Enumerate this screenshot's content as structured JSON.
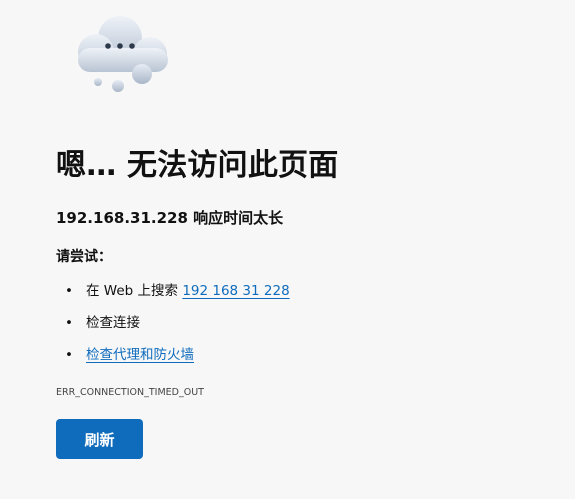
{
  "error_page": {
    "cloud_icon": "cloud-with-dots-icon",
    "title": "嗯… 无法访问此页面",
    "message": "192.168.31.228 响应时间太长",
    "try_heading": "请尝试：",
    "suggestions": [
      {
        "prefix": "在 Web 上搜索 ",
        "link": "192 168 31 228"
      },
      {
        "text": "检查连接"
      },
      {
        "link": "检查代理和防火墙"
      }
    ],
    "bullet": "•",
    "error_code": "ERR_CONNECTION_TIMED_OUT",
    "refresh_label": "刷新"
  },
  "colors": {
    "background": "#f7f7f7",
    "accent": "#0f6cbd",
    "text": "#111111"
  }
}
